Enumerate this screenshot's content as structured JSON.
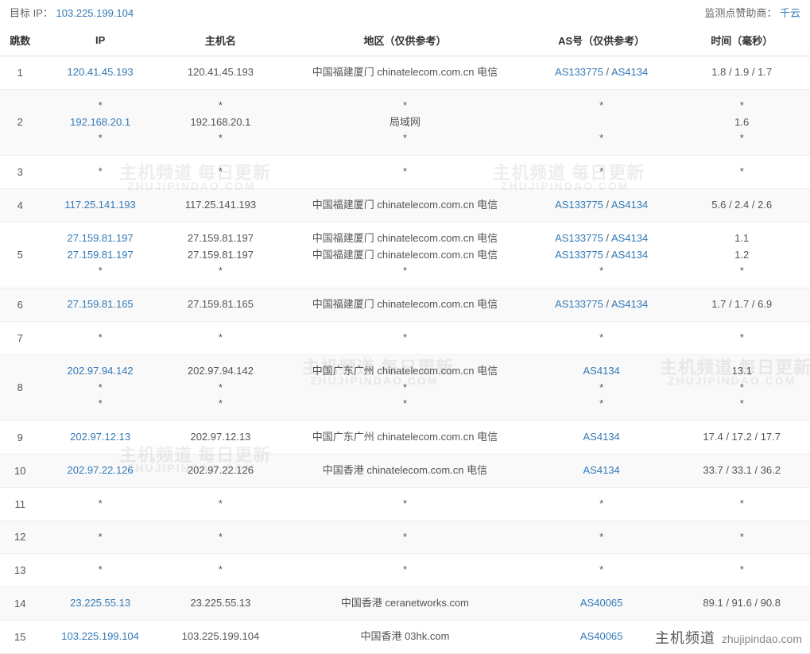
{
  "header": {
    "target_label": "目标 IP：",
    "target_ip": "103.225.199.104",
    "sponsor_label": "监测点赞助商：",
    "sponsor_name": "千云"
  },
  "columns": {
    "hop": "跳数",
    "ip": "IP",
    "host": "主机名",
    "location": "地区（仅供参考）",
    "as": "AS号（仅供参考）",
    "time": "时间（毫秒）"
  },
  "rows": [
    {
      "hop": "1",
      "ip": [
        {
          "t": "120.41.45.193",
          "link": true
        }
      ],
      "host": [
        "120.41.45.193"
      ],
      "loc": [
        "中国福建厦门 chinatelecom.com.cn 电信"
      ],
      "as": [
        [
          {
            "t": "AS133775",
            "link": true
          },
          {
            "t": " / "
          },
          {
            "t": "AS4134",
            "link": true
          }
        ]
      ],
      "time": [
        "1.8 / 1.9 / 1.7"
      ]
    },
    {
      "hop": "2",
      "ip": [
        {
          "t": "*"
        },
        {
          "t": "192.168.20.1",
          "link": true
        },
        {
          "t": "*"
        }
      ],
      "host": [
        "*",
        "192.168.20.1",
        "*"
      ],
      "loc": [
        "*",
        "局域网",
        "*"
      ],
      "as": [
        [
          {
            "t": "*"
          }
        ],
        [
          {
            "t": ""
          }
        ],
        [
          {
            "t": "*"
          }
        ]
      ],
      "time": [
        "*",
        "1.6",
        "*"
      ]
    },
    {
      "hop": "3",
      "ip": [
        {
          "t": "*"
        }
      ],
      "host": [
        "*"
      ],
      "loc": [
        "*"
      ],
      "as": [
        [
          {
            "t": "*"
          }
        ]
      ],
      "time": [
        "*"
      ]
    },
    {
      "hop": "4",
      "ip": [
        {
          "t": "117.25.141.193",
          "link": true
        }
      ],
      "host": [
        "117.25.141.193"
      ],
      "loc": [
        "中国福建厦门 chinatelecom.com.cn 电信"
      ],
      "as": [
        [
          {
            "t": "AS133775",
            "link": true
          },
          {
            "t": " / "
          },
          {
            "t": "AS4134",
            "link": true
          }
        ]
      ],
      "time": [
        "5.6 / 2.4 / 2.6"
      ]
    },
    {
      "hop": "5",
      "ip": [
        {
          "t": "27.159.81.197",
          "link": true
        },
        {
          "t": "27.159.81.197",
          "link": true
        },
        {
          "t": "*"
        }
      ],
      "host": [
        "27.159.81.197",
        "27.159.81.197",
        "*"
      ],
      "loc": [
        "中国福建厦门 chinatelecom.com.cn 电信",
        "中国福建厦门 chinatelecom.com.cn 电信",
        "*"
      ],
      "as": [
        [
          {
            "t": "AS133775",
            "link": true
          },
          {
            "t": " / "
          },
          {
            "t": "AS4134",
            "link": true
          }
        ],
        [
          {
            "t": "AS133775",
            "link": true
          },
          {
            "t": " / "
          },
          {
            "t": "AS4134",
            "link": true
          }
        ],
        [
          {
            "t": "*"
          }
        ]
      ],
      "time": [
        "1.1",
        "1.2",
        "*"
      ]
    },
    {
      "hop": "6",
      "ip": [
        {
          "t": "27.159.81.165",
          "link": true
        }
      ],
      "host": [
        "27.159.81.165"
      ],
      "loc": [
        "中国福建厦门 chinatelecom.com.cn 电信"
      ],
      "as": [
        [
          {
            "t": "AS133775",
            "link": true
          },
          {
            "t": " / "
          },
          {
            "t": "AS4134",
            "link": true
          }
        ]
      ],
      "time": [
        "1.7 / 1.7 / 6.9"
      ]
    },
    {
      "hop": "7",
      "ip": [
        {
          "t": "*"
        }
      ],
      "host": [
        "*"
      ],
      "loc": [
        "*"
      ],
      "as": [
        [
          {
            "t": "*"
          }
        ]
      ],
      "time": [
        "*"
      ]
    },
    {
      "hop": "8",
      "ip": [
        {
          "t": "202.97.94.142",
          "link": true
        },
        {
          "t": "*"
        },
        {
          "t": "*"
        }
      ],
      "host": [
        "202.97.94.142",
        "*",
        "*"
      ],
      "loc": [
        "中国广东广州 chinatelecom.com.cn 电信",
        "*",
        "*"
      ],
      "as": [
        [
          {
            "t": "AS4134",
            "link": true
          }
        ],
        [
          {
            "t": "*"
          }
        ],
        [
          {
            "t": "*"
          }
        ]
      ],
      "time": [
        "13.1",
        "*",
        "*"
      ]
    },
    {
      "hop": "9",
      "ip": [
        {
          "t": "202.97.12.13",
          "link": true
        }
      ],
      "host": [
        "202.97.12.13"
      ],
      "loc": [
        "中国广东广州 chinatelecom.com.cn 电信"
      ],
      "as": [
        [
          {
            "t": "AS4134",
            "link": true
          }
        ]
      ],
      "time": [
        "17.4 / 17.2 / 17.7"
      ]
    },
    {
      "hop": "10",
      "ip": [
        {
          "t": "202.97.22.126",
          "link": true
        }
      ],
      "host": [
        "202.97.22.126"
      ],
      "loc": [
        "中国香港 chinatelecom.com.cn 电信"
      ],
      "as": [
        [
          {
            "t": "AS4134",
            "link": true
          }
        ]
      ],
      "time": [
        "33.7 / 33.1 / 36.2"
      ]
    },
    {
      "hop": "11",
      "ip": [
        {
          "t": "*"
        }
      ],
      "host": [
        "*"
      ],
      "loc": [
        "*"
      ],
      "as": [
        [
          {
            "t": "*"
          }
        ]
      ],
      "time": [
        "*"
      ]
    },
    {
      "hop": "12",
      "ip": [
        {
          "t": "*"
        }
      ],
      "host": [
        "*"
      ],
      "loc": [
        "*"
      ],
      "as": [
        [
          {
            "t": "*"
          }
        ]
      ],
      "time": [
        "*"
      ]
    },
    {
      "hop": "13",
      "ip": [
        {
          "t": "*"
        }
      ],
      "host": [
        "*"
      ],
      "loc": [
        "*"
      ],
      "as": [
        [
          {
            "t": "*"
          }
        ]
      ],
      "time": [
        "*"
      ]
    },
    {
      "hop": "14",
      "ip": [
        {
          "t": "23.225.55.13",
          "link": true
        }
      ],
      "host": [
        "23.225.55.13"
      ],
      "loc": [
        "中国香港 ceranetworks.com"
      ],
      "as": [
        [
          {
            "t": "AS40065",
            "link": true
          }
        ]
      ],
      "time": [
        "89.1 / 91.6 / 90.8"
      ]
    },
    {
      "hop": "15",
      "ip": [
        {
          "t": "103.225.199.104",
          "link": true
        }
      ],
      "host": [
        "103.225.199.104"
      ],
      "loc": [
        "中国香港 03hk.com"
      ],
      "as": [
        [
          {
            "t": "AS40065",
            "link": true
          }
        ]
      ],
      "time": [
        ""
      ]
    }
  ],
  "watermark": {
    "cn": "主机频道 每日更新",
    "en": "ZHUJIPINDAO.COM"
  },
  "brand": {
    "cn": "主机频道",
    "dom": "zhujipindao.com"
  }
}
